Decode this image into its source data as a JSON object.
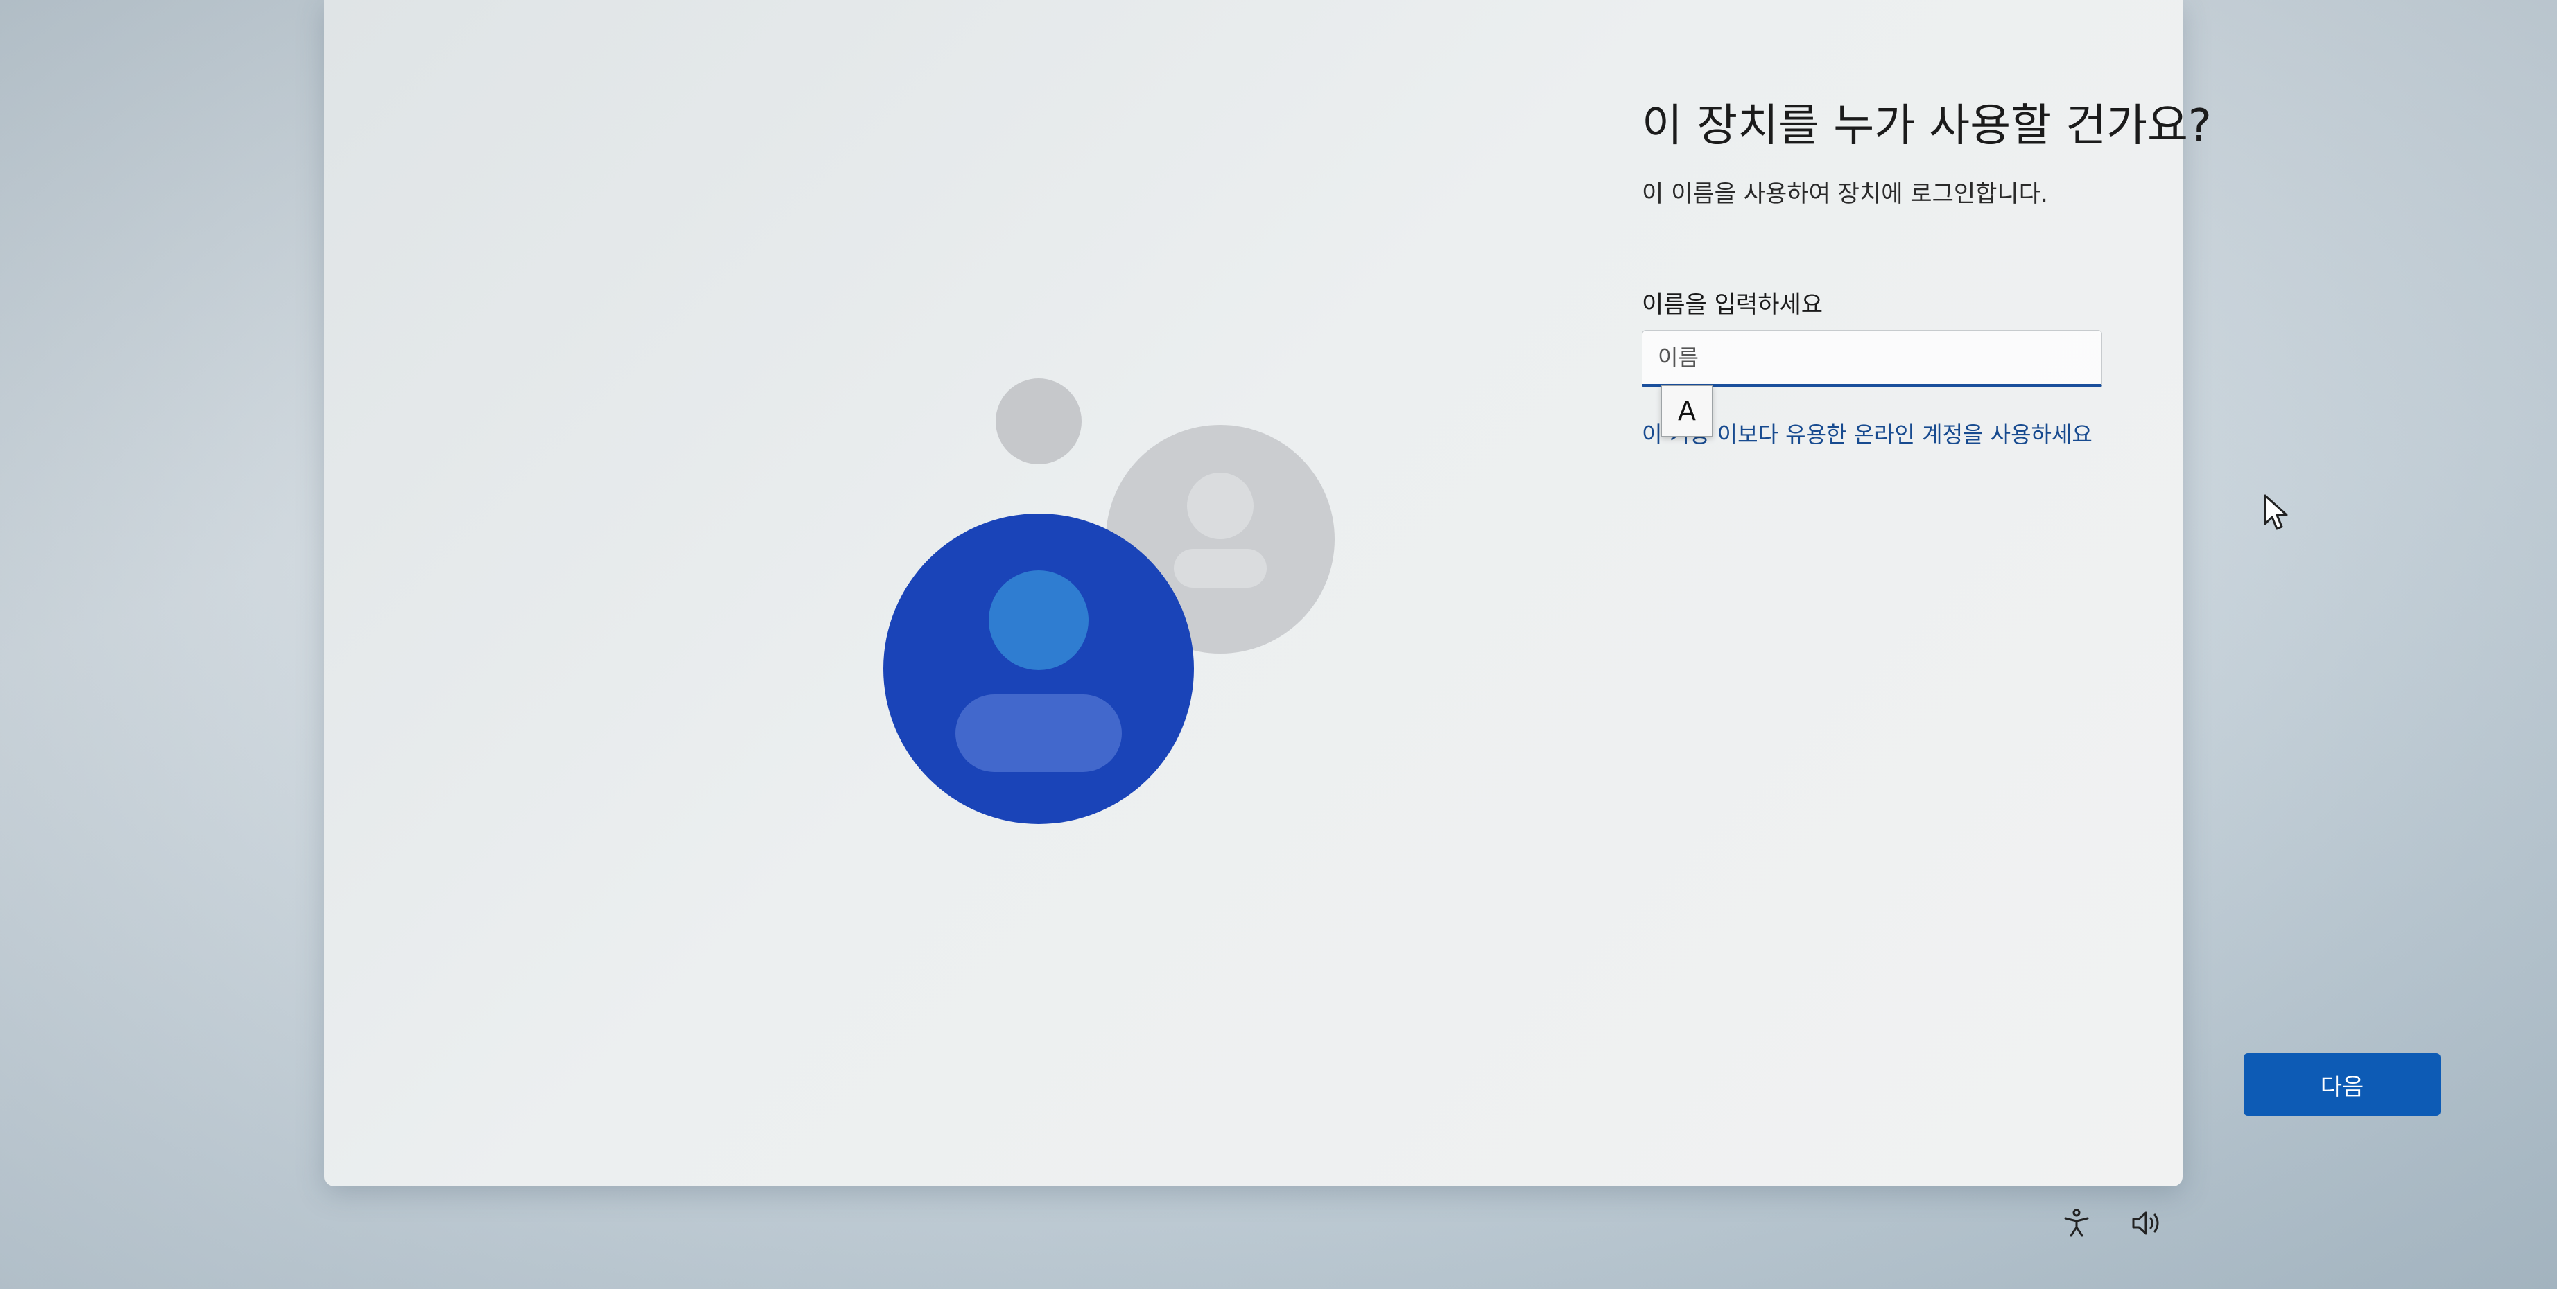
{
  "setup": {
    "title": "이 장치를 누가 사용할 건가요?",
    "subtitle": "이 이름을 사용하여 장치에 로그인합니다.",
    "name_label": "이름을 입력하세요",
    "name_input": {
      "value": "",
      "placeholder": "이름"
    },
    "ime_indicator": "A",
    "online_account_link": "이 기능 이보다 유용한 온라인 계정을 사용하세요",
    "next_label": "다음"
  },
  "icons": {
    "illustration": "user-avatars-illustration",
    "accessibility": "accessibility-icon",
    "volume": "volume-icon",
    "cursor": "mouse-pointer-icon"
  },
  "colors": {
    "accent": "#0d5bb5",
    "avatar_primary": "#1a44b8",
    "avatar_secondary": "#c5c7ca",
    "link": "#174a8f"
  }
}
